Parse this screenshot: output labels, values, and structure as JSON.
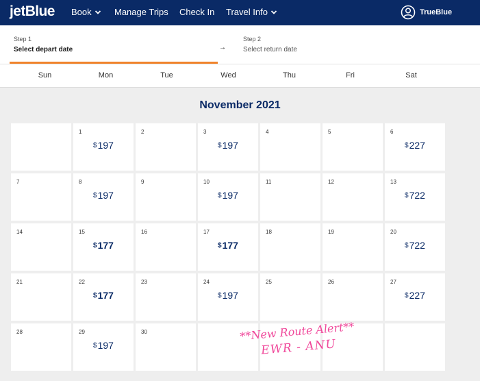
{
  "header": {
    "logo": "jetBlue",
    "nav": [
      {
        "label": "Book",
        "has_dropdown": true
      },
      {
        "label": "Manage Trips",
        "has_dropdown": false
      },
      {
        "label": "Check In",
        "has_dropdown": false
      },
      {
        "label": "Travel Info",
        "has_dropdown": true
      }
    ],
    "account_label": "TrueBlue",
    "account_icon": "user-circle-icon",
    "brand_color": "#0a2a66"
  },
  "steps": {
    "step1": {
      "small": "Step 1",
      "label": "Select depart date"
    },
    "arrow": "→",
    "step2": {
      "small": "Step 2",
      "label": "Select return date"
    },
    "active_color": "#f0832a"
  },
  "weekdays": [
    "Sun",
    "Mon",
    "Tue",
    "Wed",
    "Thu",
    "Fri",
    "Sat"
  ],
  "calendar": {
    "title": "November 2021",
    "currency": "$",
    "days": [
      {
        "day": 1,
        "price": "197",
        "lowest": false
      },
      {
        "day": 2,
        "price": "",
        "lowest": false
      },
      {
        "day": 3,
        "price": "197",
        "lowest": false
      },
      {
        "day": 4,
        "price": "",
        "lowest": false
      },
      {
        "day": 5,
        "price": "",
        "lowest": false
      },
      {
        "day": 6,
        "price": "227",
        "lowest": false
      },
      {
        "day": 7,
        "price": "",
        "lowest": false
      },
      {
        "day": 8,
        "price": "197",
        "lowest": false
      },
      {
        "day": 9,
        "price": "",
        "lowest": false
      },
      {
        "day": 10,
        "price": "197",
        "lowest": false
      },
      {
        "day": 11,
        "price": "",
        "lowest": false
      },
      {
        "day": 12,
        "price": "",
        "lowest": false
      },
      {
        "day": 13,
        "price": "722",
        "lowest": false
      },
      {
        "day": 14,
        "price": "",
        "lowest": false
      },
      {
        "day": 15,
        "price": "177",
        "lowest": true
      },
      {
        "day": 16,
        "price": "",
        "lowest": false
      },
      {
        "day": 17,
        "price": "177",
        "lowest": true
      },
      {
        "day": 18,
        "price": "",
        "lowest": false
      },
      {
        "day": 19,
        "price": "",
        "lowest": false
      },
      {
        "day": 20,
        "price": "722",
        "lowest": false
      },
      {
        "day": 21,
        "price": "",
        "lowest": false
      },
      {
        "day": 22,
        "price": "177",
        "lowest": true
      },
      {
        "day": 23,
        "price": "",
        "lowest": false
      },
      {
        "day": 24,
        "price": "197",
        "lowest": false
      },
      {
        "day": 25,
        "price": "",
        "lowest": false
      },
      {
        "day": 26,
        "price": "",
        "lowest": false
      },
      {
        "day": 27,
        "price": "227",
        "lowest": false
      },
      {
        "day": 28,
        "price": "",
        "lowest": false
      },
      {
        "day": 29,
        "price": "197",
        "lowest": false
      },
      {
        "day": 30,
        "price": "",
        "lowest": false
      }
    ],
    "first_weekday_index": 1
  },
  "promo": {
    "line1": "**New Route Alert**",
    "line2": "EWR - ANU",
    "color": "#f0479a"
  }
}
